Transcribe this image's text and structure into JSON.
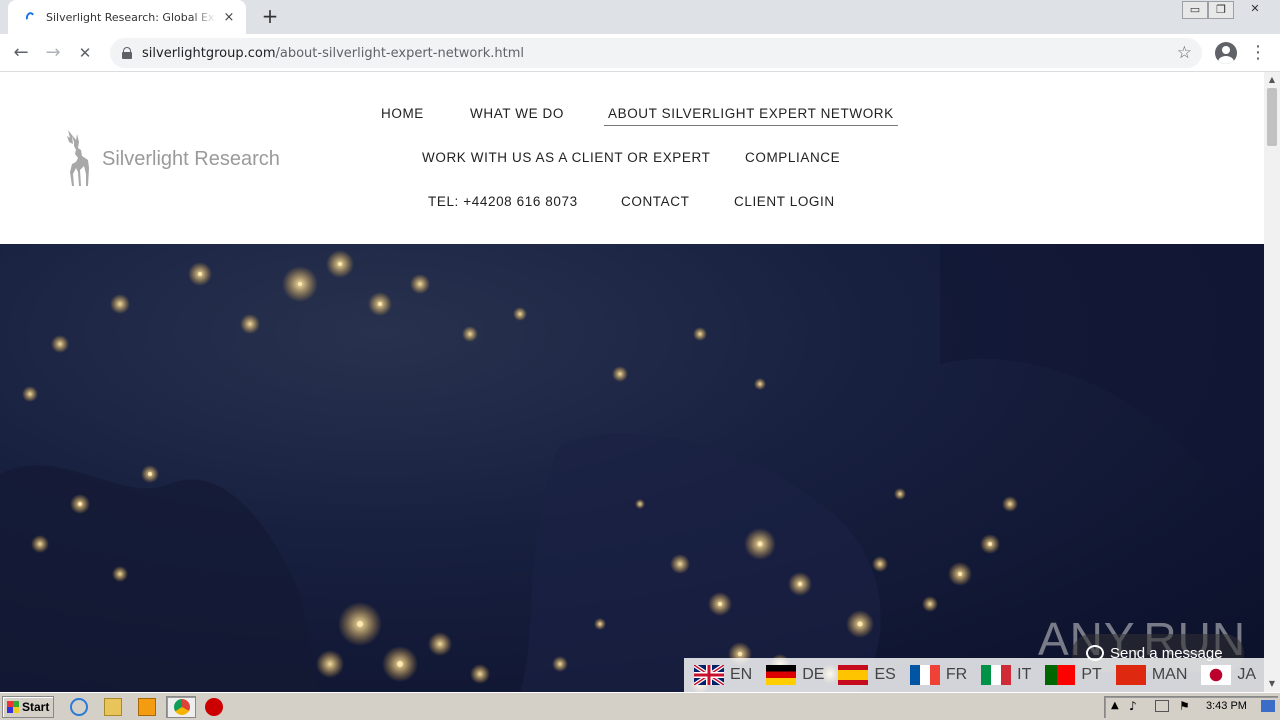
{
  "browser": {
    "tab_title": "Silverlight Research: Global Expert N",
    "tab_close": "×",
    "new_tab": "+",
    "url_domain": "silverlightgroup.com",
    "url_path": "/about-silverlight-expert-network.html",
    "back_icon": "←",
    "forward_icon": "→",
    "stop_icon": "✕",
    "star_icon": "☆",
    "menu_icon": "⋮",
    "win_min": "▭",
    "win_restore": "❐",
    "win_close": "✕"
  },
  "site": {
    "logo_text": "Silverlight Research",
    "nav": [
      {
        "label": "HOME"
      },
      {
        "label": "WHAT WE DO"
      },
      {
        "label": "ABOUT SILVERLIGHT EXPERT NETWORK"
      },
      {
        "label": "WORK WITH US AS A CLIENT OR EXPERT"
      },
      {
        "label": "COMPLIANCE"
      },
      {
        "label": "TEL: +44208 616 8073"
      },
      {
        "label": "CONTACT"
      },
      {
        "label": "CLIENT LOGIN"
      }
    ],
    "active_nav": "ABOUT SILVERLIGHT EXPERT NETWORK"
  },
  "languages": [
    {
      "code": "EN"
    },
    {
      "code": "DE"
    },
    {
      "code": "ES"
    },
    {
      "code": "FR"
    },
    {
      "code": "IT"
    },
    {
      "code": "PT"
    },
    {
      "code": "MAN"
    },
    {
      "code": "JA"
    }
  ],
  "chat": {
    "label": "Send a message"
  },
  "watermark": "ANY.RUN",
  "taskbar": {
    "start_label": "Start",
    "clock": "3:43 PM"
  }
}
